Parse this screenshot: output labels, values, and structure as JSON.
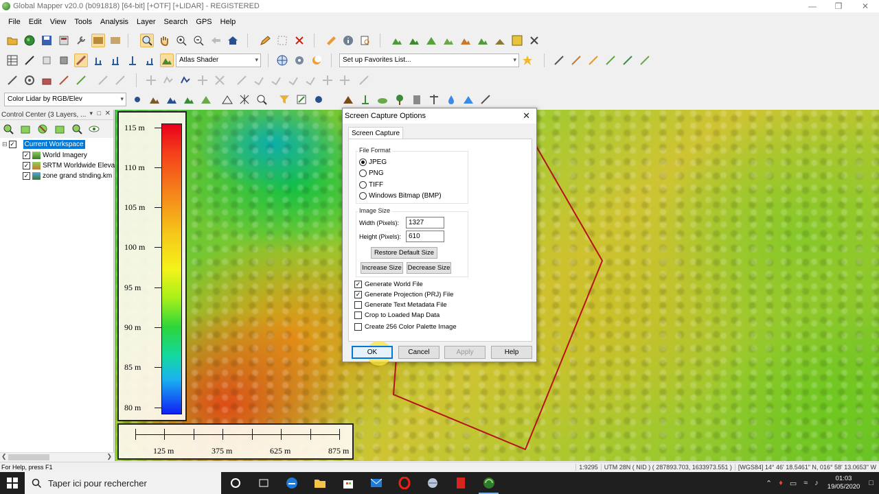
{
  "window": {
    "title": "Global Mapper v20.0 (b091818) [64-bit] [+OTF] [+LIDAR] - REGISTERED"
  },
  "menu": [
    "File",
    "Edit",
    "View",
    "Tools",
    "Analysis",
    "Layer",
    "Search",
    "GPS",
    "Help"
  ],
  "toolbar": {
    "shader": "Atlas Shader",
    "favorites": "Set up Favorites List...",
    "lidar_color": "Color Lidar by RGB/Elev"
  },
  "control_center": {
    "title": "Control Center (3 Layers, ...",
    "workspace": "Current Workspace",
    "layers": [
      "World Imagery",
      "SRTM Worldwide Elevat",
      "zone grand stnding.km"
    ]
  },
  "legend": {
    "labels": [
      "115 m",
      "110 m",
      "105 m",
      "100 m",
      "95 m",
      "90 m",
      "85 m",
      "80 m"
    ]
  },
  "scale_bar": {
    "labels": [
      "125 m",
      "375 m",
      "625 m",
      "875 m"
    ]
  },
  "dialog": {
    "title": "Screen Capture Options",
    "tab": "Screen Capture",
    "file_format": {
      "label": "File Format",
      "options": [
        "JPEG",
        "PNG",
        "TIFF",
        "Windows Bitmap (BMP)"
      ],
      "selected": "JPEG"
    },
    "image_size": {
      "label": "Image Size",
      "width_label": "Width (Pixels):",
      "width": "1327",
      "height_label": "Height (Pixels):",
      "height": "610",
      "restore": "Restore Default Size",
      "increase": "Increase Size",
      "decrease": "Decrease Size"
    },
    "checkboxes": [
      {
        "label": "Generate World File",
        "checked": true
      },
      {
        "label": "Generate Projection (PRJ) File",
        "checked": true
      },
      {
        "label": "Generate Text Metadata File",
        "checked": false
      },
      {
        "label": "Crop to Loaded Map Data",
        "checked": false
      },
      {
        "label": "Create 256 Color Palette Image",
        "checked": false
      }
    ],
    "buttons": {
      "ok": "OK",
      "cancel": "Cancel",
      "apply": "Apply",
      "help": "Help"
    }
  },
  "status": {
    "help": "For Help, press F1",
    "scale": "1:9295",
    "projection": "UTM 28N ( NID ) ( 287893.703, 1633973.551 )",
    "coords": "[WGS84] 14° 46' 18.5461\" N, 016° 58' 13.0653\" W"
  },
  "taskbar": {
    "search_placeholder": "Taper ici pour rechercher",
    "time": "01:03",
    "date": "19/05/2020"
  },
  "colors": {
    "accent": "#0078d7",
    "boundary": "#b5121b",
    "taskbar": "#1f1f1f"
  }
}
